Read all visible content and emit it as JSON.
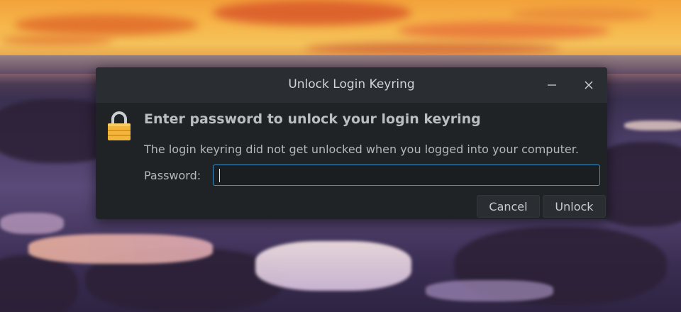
{
  "dialog": {
    "title": "Unlock Login Keyring",
    "heading": "Enter password to unlock your login keyring",
    "description": "The login keyring did not get unlocked when you logged into your computer.",
    "password_label": "Password:",
    "password_value": "",
    "cancel_label": "Cancel",
    "unlock_label": "Unlock"
  },
  "icons": {
    "lock": "lock-icon",
    "minimize": "minimize-icon",
    "close": "close-icon"
  },
  "colors": {
    "dialog_bg": "#202326",
    "titlebar_bg": "#2a2e32",
    "focus_border": "#3d8fc6",
    "lock_body": "#f4b63a"
  }
}
